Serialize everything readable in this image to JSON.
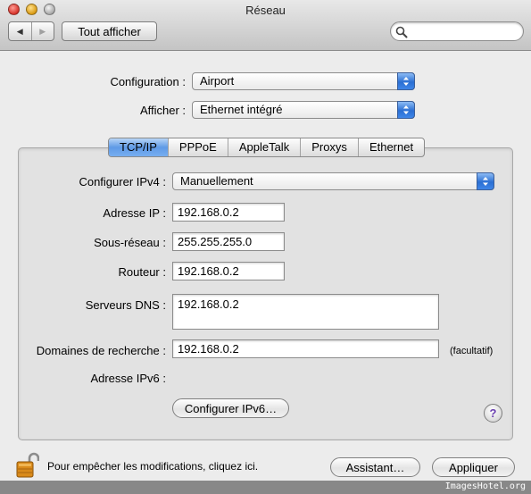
{
  "window": {
    "title": "Réseau"
  },
  "toolbar": {
    "back_glyph": "◀",
    "forward_glyph": "▶",
    "show_all_label": "Tout afficher",
    "search": {
      "value": "",
      "placeholder": ""
    }
  },
  "top": {
    "configuration": {
      "label": "Configuration :",
      "value": "Airport"
    },
    "show": {
      "label": "Afficher :",
      "value": "Ethernet intégré"
    }
  },
  "tabs": [
    {
      "label": "TCP/IP",
      "active": true
    },
    {
      "label": "PPPoE",
      "active": false
    },
    {
      "label": "AppleTalk",
      "active": false
    },
    {
      "label": "Proxys",
      "active": false
    },
    {
      "label": "Ethernet",
      "active": false
    }
  ],
  "tcpip": {
    "configure_ipv4": {
      "label": "Configurer IPv4 :",
      "value": "Manuellement"
    },
    "ip_address": {
      "label": "Adresse IP :",
      "value": "192.168.0.2"
    },
    "subnet": {
      "label": "Sous-réseau :",
      "value": "255.255.255.0"
    },
    "router": {
      "label": "Routeur :",
      "value": "192.168.0.2"
    },
    "dns": {
      "label": "Serveurs DNS :",
      "value": "192.168.0.2"
    },
    "search_domains": {
      "label": "Domaines de recherche :",
      "value": "192.168.0.2",
      "hint": "(facultatif)"
    },
    "ipv6_address": {
      "label": "Adresse IPv6 :"
    },
    "configure_ipv6_button": "Configurer IPv6…",
    "help_glyph": "?"
  },
  "footer": {
    "lock_text": "Pour empêcher les modifications, cliquez ici.",
    "assistant_button": "Assistant…",
    "apply_button": "Appliquer"
  },
  "watermark": "ImagesHotel.org",
  "colors": {
    "tab_active": "#5f9ae6",
    "popup_arrows": "#2b6fd3",
    "help_glyph": "#6a3fb0",
    "lock_body": "#d98a1a"
  }
}
